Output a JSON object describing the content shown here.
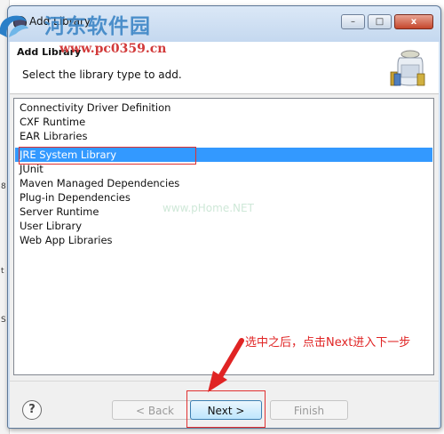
{
  "window": {
    "title": "Add Library",
    "controls": [
      "–",
      "□",
      "x"
    ]
  },
  "watermark": {
    "title": "河东软件园",
    "url": "www.pc0359.cn",
    "faint": "www.pHome.NET"
  },
  "header": {
    "title": "Add Library",
    "description": "Select the library type to add."
  },
  "library_types": {
    "items": [
      "Connectivity Driver Definition",
      "CXF Runtime",
      "EAR Libraries",
      "JRE System Library",
      "JUnit",
      "Maven Managed Dependencies",
      "Plug-in Dependencies",
      "Server Runtime",
      "User Library",
      "Web App Libraries"
    ],
    "selected": "JRE System Library"
  },
  "annotation": "选中之后，点击Next进入下一步",
  "buttons": {
    "help": "?",
    "back": "< Back",
    "next": "Next >",
    "finish": "Finish"
  },
  "colors": {
    "selection": "#3399ff",
    "highlight_box": "#e03030",
    "annotation": "#e02424"
  }
}
